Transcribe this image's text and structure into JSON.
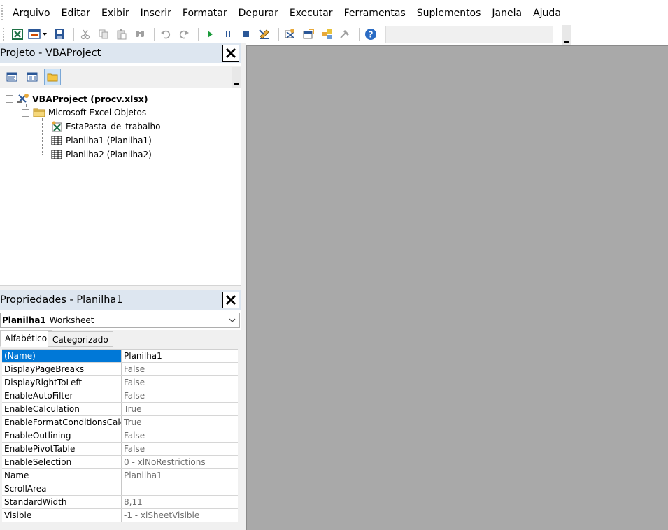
{
  "menubar": {
    "items": [
      {
        "label": "Arquivo"
      },
      {
        "label": "Editar"
      },
      {
        "label": "Exibir"
      },
      {
        "label": "Inserir"
      },
      {
        "label": "Formatar"
      },
      {
        "label": "Depurar"
      },
      {
        "label": "Executar"
      },
      {
        "label": "Ferramentas"
      },
      {
        "label": "Suplementos"
      },
      {
        "label": "Janela"
      },
      {
        "label": "Ajuda"
      }
    ]
  },
  "project_pane": {
    "title": "Projeto - VBAProject",
    "tree": {
      "root": "VBAProject (procv.xlsx)",
      "folder": "Microsoft Excel Objetos",
      "items": [
        "EstaPasta_de_trabalho",
        "Planilha1 (Planilha1)",
        "Planilha2 (Planilha2)"
      ]
    }
  },
  "properties_pane": {
    "title": "Propriedades - Planilha1",
    "object_name": "Planilha1",
    "object_type": "Worksheet",
    "tabs": [
      "Alfabético",
      "Categorizado"
    ],
    "rows": [
      {
        "name": "(Name)",
        "value": "Planilha1"
      },
      {
        "name": "DisplayPageBreaks",
        "value": "False"
      },
      {
        "name": "DisplayRightToLeft",
        "value": "False"
      },
      {
        "name": "EnableAutoFilter",
        "value": "False"
      },
      {
        "name": "EnableCalculation",
        "value": "True"
      },
      {
        "name": "EnableFormatConditionsCalculation",
        "value": "True"
      },
      {
        "name": "EnableOutlining",
        "value": "False"
      },
      {
        "name": "EnablePivotTable",
        "value": "False"
      },
      {
        "name": "EnableSelection",
        "value": "0 - xlNoRestrictions"
      },
      {
        "name": "Name",
        "value": "Planilha1"
      },
      {
        "name": "ScrollArea",
        "value": ""
      },
      {
        "name": "StandardWidth",
        "value": "8,11"
      },
      {
        "name": "Visible",
        "value": "-1 - xlSheetVisible"
      }
    ]
  },
  "colors": {
    "pane_title_bg": "#dde6f0",
    "selection": "#0078d7",
    "mdi_bg": "#a9a9a9"
  }
}
